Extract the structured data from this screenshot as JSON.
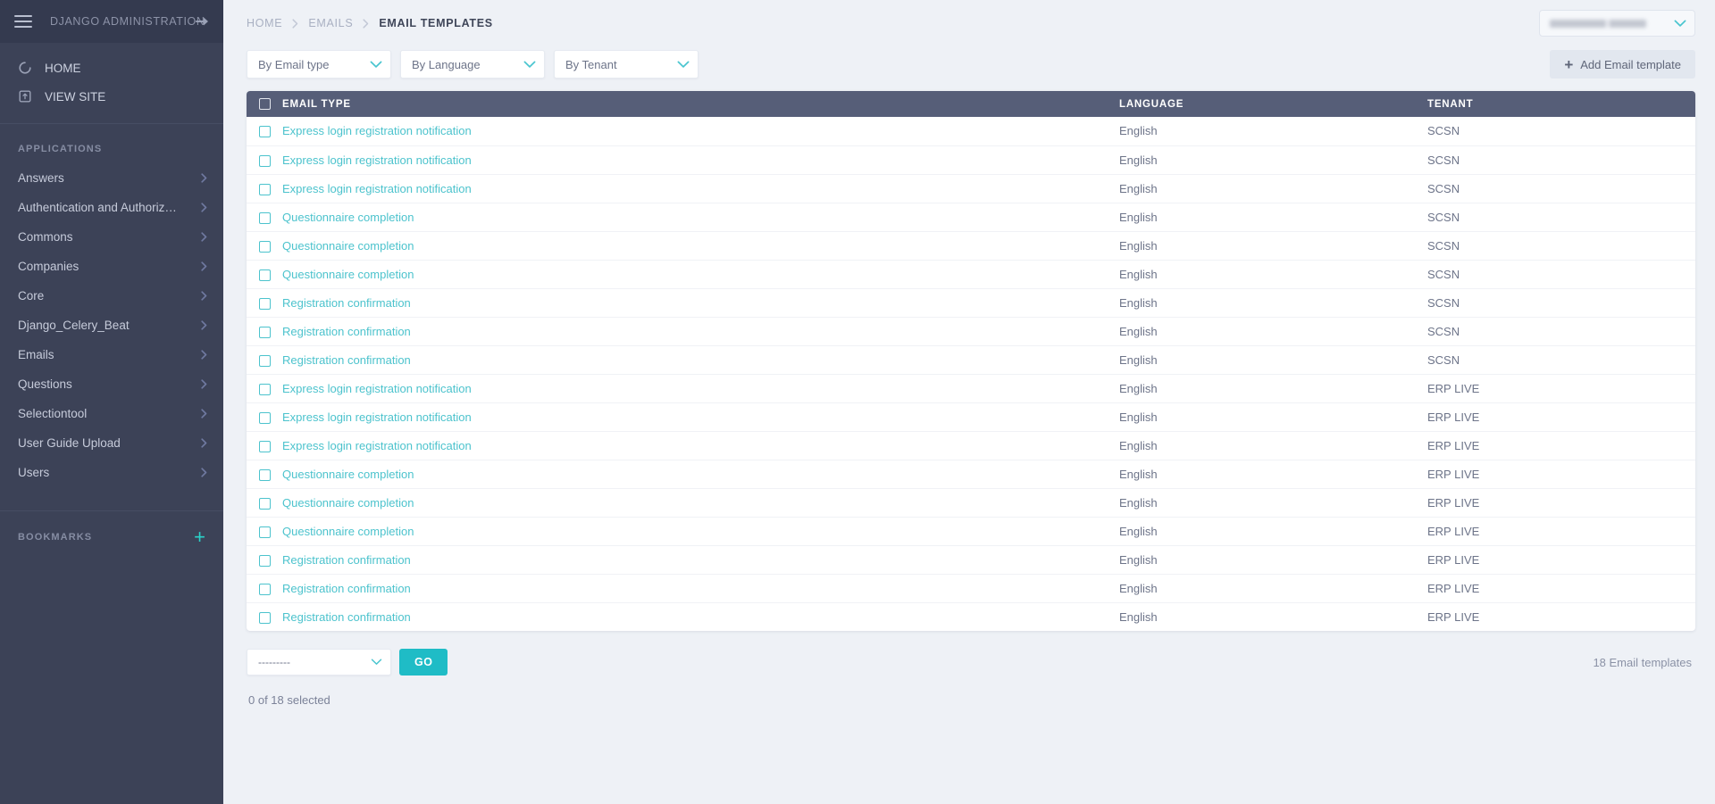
{
  "sidebar": {
    "brand": "DJANGO ADMINISTRATION",
    "burger_icon": "hamburger-menu-icon",
    "pin_icon": "pin-sidebar-icon",
    "nav": [
      {
        "label": "HOME",
        "icon": "circle-home-icon"
      },
      {
        "label": "VIEW SITE",
        "icon": "external-link-icon"
      }
    ],
    "applications_title": "APPLICATIONS",
    "applications": [
      {
        "label": "Answers"
      },
      {
        "label": "Authentication and Authoriz…"
      },
      {
        "label": "Commons"
      },
      {
        "label": "Companies"
      },
      {
        "label": "Core"
      },
      {
        "label": "Django_Celery_Beat"
      },
      {
        "label": "Emails"
      },
      {
        "label": "Questions"
      },
      {
        "label": "Selectiontool"
      },
      {
        "label": "User Guide Upload"
      },
      {
        "label": "Users"
      }
    ],
    "bookmarks_title": "BOOKMARKS",
    "bookmarks_add_icon": "plus-icon",
    "bookmarks_add_label": "+"
  },
  "topbar": {
    "breadcrumb": [
      {
        "label": "HOME",
        "current": false
      },
      {
        "label": "EMAILS",
        "current": false
      },
      {
        "label": "EMAIL TEMPLATES",
        "current": true
      }
    ],
    "separator": "chevron-right-icon",
    "user_menu": {
      "name": "",
      "redacted": true,
      "caret_icon": "chevron-down-icon"
    }
  },
  "filters": [
    {
      "label": "By Email type",
      "name": "filter-email-type"
    },
    {
      "label": "By Language",
      "name": "filter-language"
    },
    {
      "label": "By Tenant",
      "name": "filter-tenant"
    }
  ],
  "add_button": {
    "label": "Add Email template",
    "icon": "plus-icon"
  },
  "table": {
    "columns": [
      "EMAIL TYPE",
      "LANGUAGE",
      "TENANT"
    ],
    "select_all_icon": "checkbox-unchecked-icon",
    "rows": [
      {
        "email_type": "Express login registration notification",
        "language": "English",
        "tenant": "SCSN"
      },
      {
        "email_type": "Express login registration notification",
        "language": "English",
        "tenant": "SCSN"
      },
      {
        "email_type": "Express login registration notification",
        "language": "English",
        "tenant": "SCSN"
      },
      {
        "email_type": "Questionnaire completion",
        "language": "English",
        "tenant": "SCSN"
      },
      {
        "email_type": "Questionnaire completion",
        "language": "English",
        "tenant": "SCSN"
      },
      {
        "email_type": "Questionnaire completion",
        "language": "English",
        "tenant": "SCSN"
      },
      {
        "email_type": "Registration confirmation",
        "language": "English",
        "tenant": "SCSN"
      },
      {
        "email_type": "Registration confirmation",
        "language": "English",
        "tenant": "SCSN"
      },
      {
        "email_type": "Registration confirmation",
        "language": "English",
        "tenant": "SCSN"
      },
      {
        "email_type": "Express login registration notification",
        "language": "English",
        "tenant": "ERP LIVE"
      },
      {
        "email_type": "Express login registration notification",
        "language": "English",
        "tenant": "ERP LIVE"
      },
      {
        "email_type": "Express login registration notification",
        "language": "English",
        "tenant": "ERP LIVE"
      },
      {
        "email_type": "Questionnaire completion",
        "language": "English",
        "tenant": "ERP LIVE"
      },
      {
        "email_type": "Questionnaire completion",
        "language": "English",
        "tenant": "ERP LIVE"
      },
      {
        "email_type": "Questionnaire completion",
        "language": "English",
        "tenant": "ERP LIVE"
      },
      {
        "email_type": "Registration confirmation",
        "language": "English",
        "tenant": "ERP LIVE"
      },
      {
        "email_type": "Registration confirmation",
        "language": "English",
        "tenant": "ERP LIVE"
      },
      {
        "email_type": "Registration confirmation",
        "language": "English",
        "tenant": "ERP LIVE"
      }
    ]
  },
  "footer": {
    "action_select_value": "---------",
    "go_label": "GO",
    "selected_text": "0 of 18 selected",
    "total_text": "18 Email templates"
  },
  "colors": {
    "sidebar_bg": "#3c4257",
    "sidebar_header_bg": "#343a4f",
    "page_bg": "#eef1f6",
    "table_header_bg": "#565e78",
    "accent_teal": "#4cc3cd",
    "go_button": "#1fbcc6",
    "bookmark_plus": "#2ad2c9"
  }
}
